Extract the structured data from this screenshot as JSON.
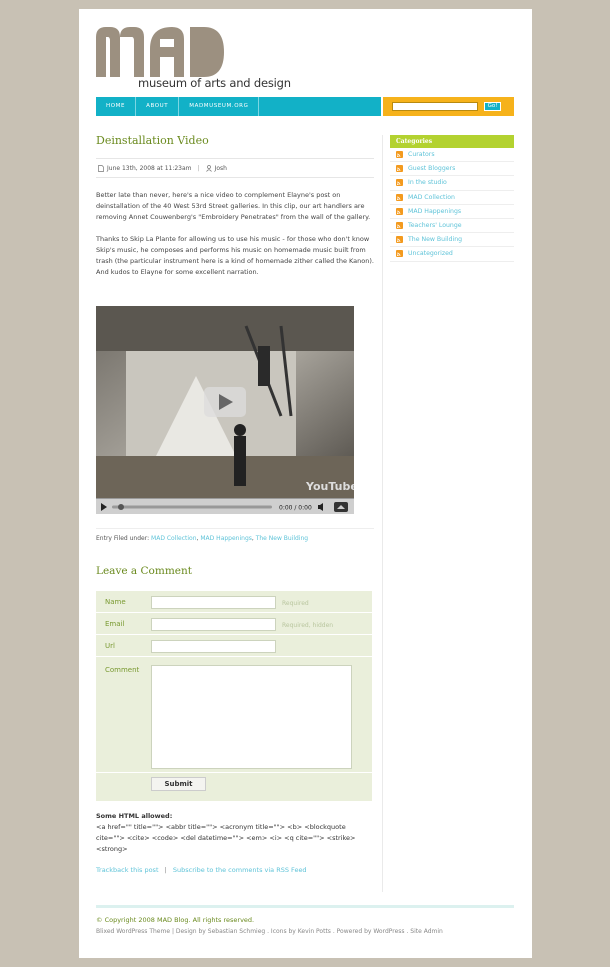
{
  "site": {
    "logo_text": "museum of arts and design",
    "nav": [
      "HOME",
      "ABOUT",
      "MADMUSEUM.ORG"
    ],
    "search_button": "Go!"
  },
  "post": {
    "title": "Deinstallation Video",
    "date": "June 13th, 2008 at 11:23am",
    "author": "Josh",
    "paragraph1": "Better late than never, here's a nice video to complement Elayne's post on deinstallation of the 40 West 53rd Street galleries. In this clip, our art handlers are removing Annet Couwenberg's \"Embroidery Penetrates\" from the wall of the gallery.",
    "paragraph2": "Thanks to Skip La Plante for allowing us to use his music - for those who don't know Skip's music, he composes and performs his music on homemade music built from trash (the particular instrument here is a kind of homemade zither called the Kanon). And kudos to Elayne for some excellent narration.",
    "video_time": "0:00 / 0:00",
    "video_watermark": "YouTube",
    "filed_label": "Entry Filed under:",
    "filed_categories": [
      "MAD Collection",
      "MAD Happenings",
      "The New Building"
    ]
  },
  "comment_form": {
    "title": "Leave a Comment",
    "name_label": "Name",
    "name_note": "Required",
    "email_label": "Email",
    "email_note": "Required, hidden",
    "url_label": "Url",
    "comment_label": "Comment",
    "submit_label": "Submit",
    "html_allowed_title": "Some HTML allowed:",
    "html_allowed_text": "<a href=\"\" title=\"\"> <abbr title=\"\"> <acronym title=\"\"> <b> <blockquote cite=\"\"> <cite> <code> <del datetime=\"\"> <em> <i> <q cite=\"\"> <strike> <strong>",
    "trackback": "Trackback this post",
    "separator": "|",
    "subscribe": "Subscribe to the comments via RSS Feed"
  },
  "sidebar": {
    "categories_title": "Categories",
    "categories": [
      "Curators",
      "Guest Bloggers",
      "In the studio",
      "MAD Collection",
      "MAD Happenings",
      "Teachers' Lounge",
      "The New Building",
      "Uncategorized"
    ]
  },
  "footer": {
    "copyright": "© Copyright 2008 MAD Blog. All rights reserved.",
    "credits": "Blixed WordPress Theme | Design by Sebastian Schmieg . Icons by Kevin Potts . Powered by WordPress . Site Admin"
  },
  "colors": {
    "accent_teal": "#12b1c7",
    "accent_orange": "#f6b21b",
    "accent_green": "#b3d230",
    "title_green": "#6a8a1e",
    "link_blue": "#5ec3d8",
    "form_bg": "#eaefdb",
    "page_bg": "#c8c1b4"
  }
}
